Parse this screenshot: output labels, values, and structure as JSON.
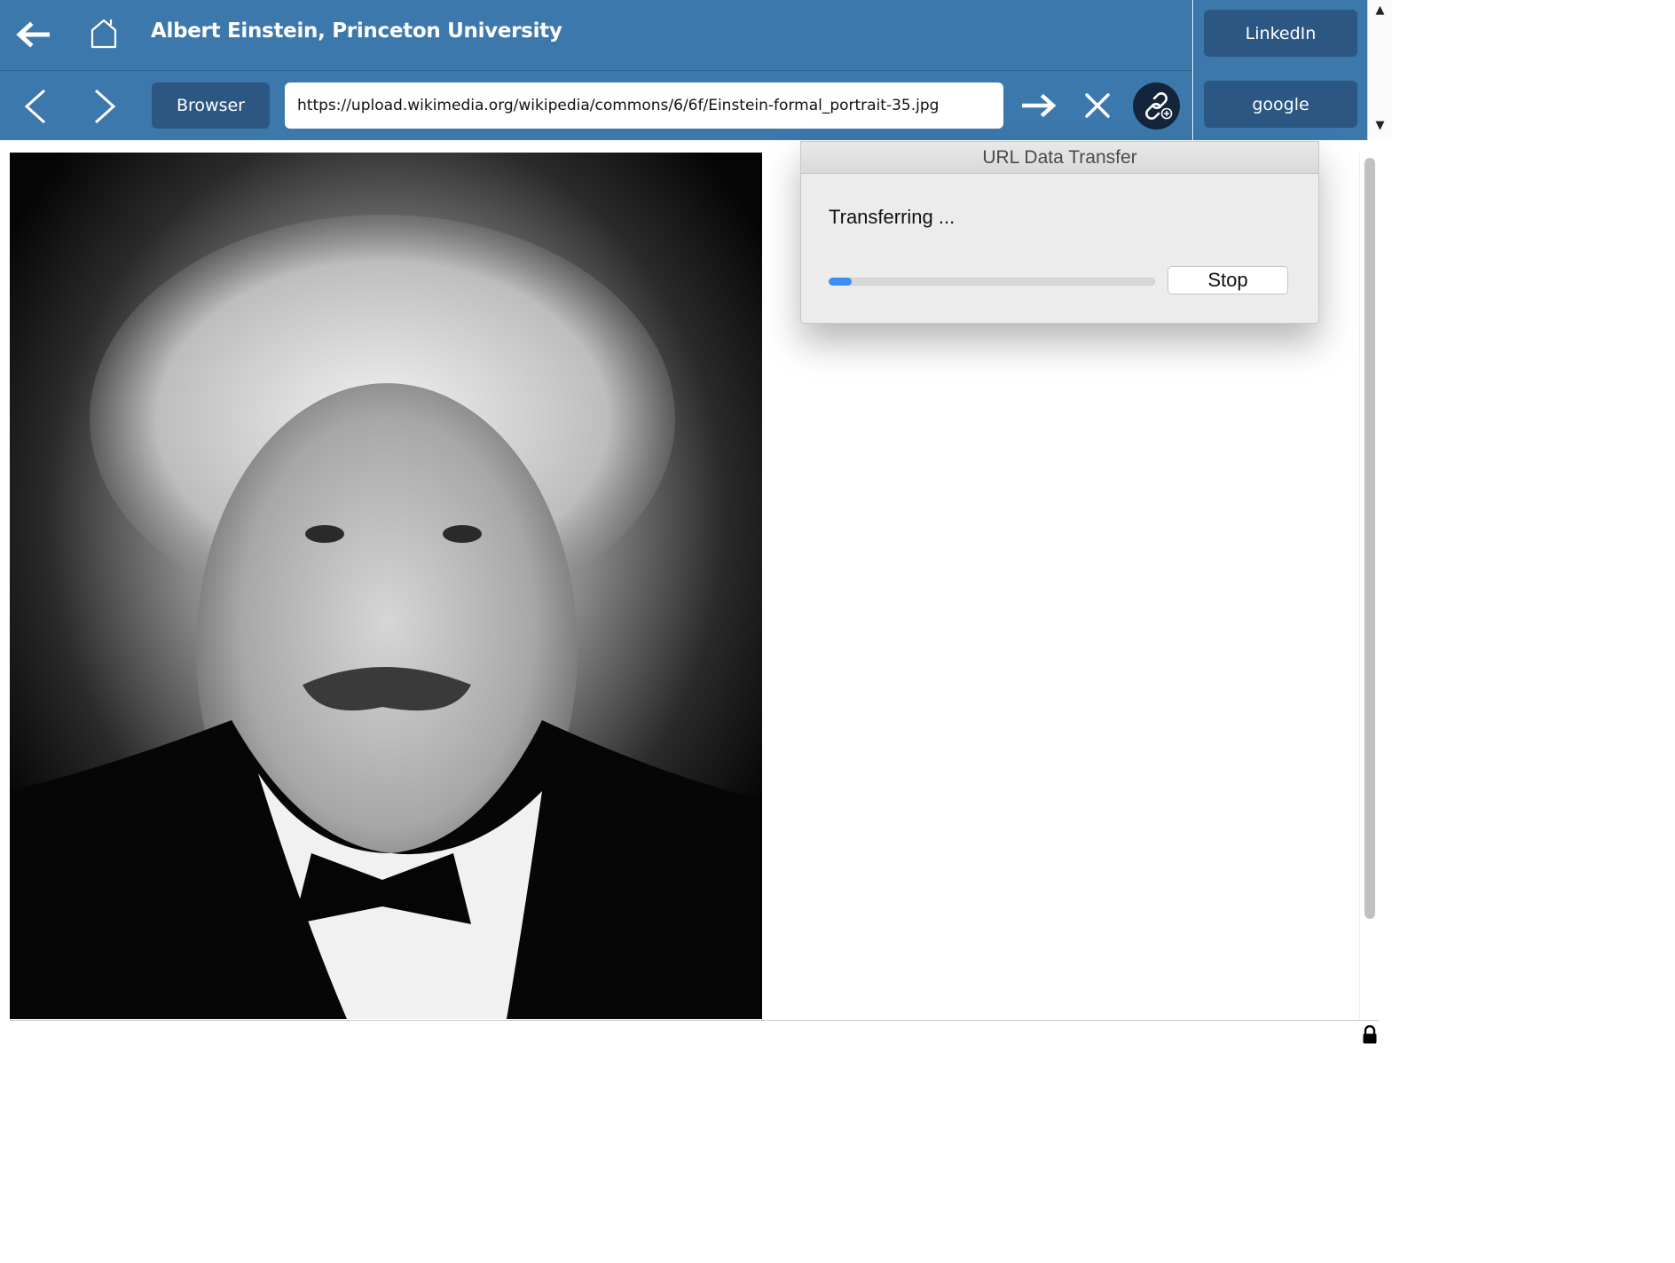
{
  "header": {
    "title": "Albert Einstein, Princeton University"
  },
  "nav": {
    "browser_label": "Browser",
    "url_value": "https://upload.wikimedia.org/wikipedia/commons/6/6f/Einstein-formal_portrait-35.jpg"
  },
  "side_panel": {
    "bookmarks": [
      {
        "label": "LinkedIn"
      },
      {
        "label": "google"
      }
    ]
  },
  "dialog": {
    "title": "URL Data Transfer",
    "status": "Transferring ...",
    "progress_fraction": 0.07,
    "stop_label": "Stop"
  },
  "colors": {
    "toolbar_blue": "#3c78ac",
    "button_dark_blue": "#2c5783",
    "progress_blue": "#3d8ef0"
  },
  "icons": {
    "back": "back-arrow-icon",
    "home": "home-icon",
    "prev": "chevron-left-icon",
    "next": "chevron-right-icon",
    "go": "arrow-right-icon",
    "clear": "close-icon",
    "link": "link-add-icon",
    "lock": "lock-icon"
  }
}
